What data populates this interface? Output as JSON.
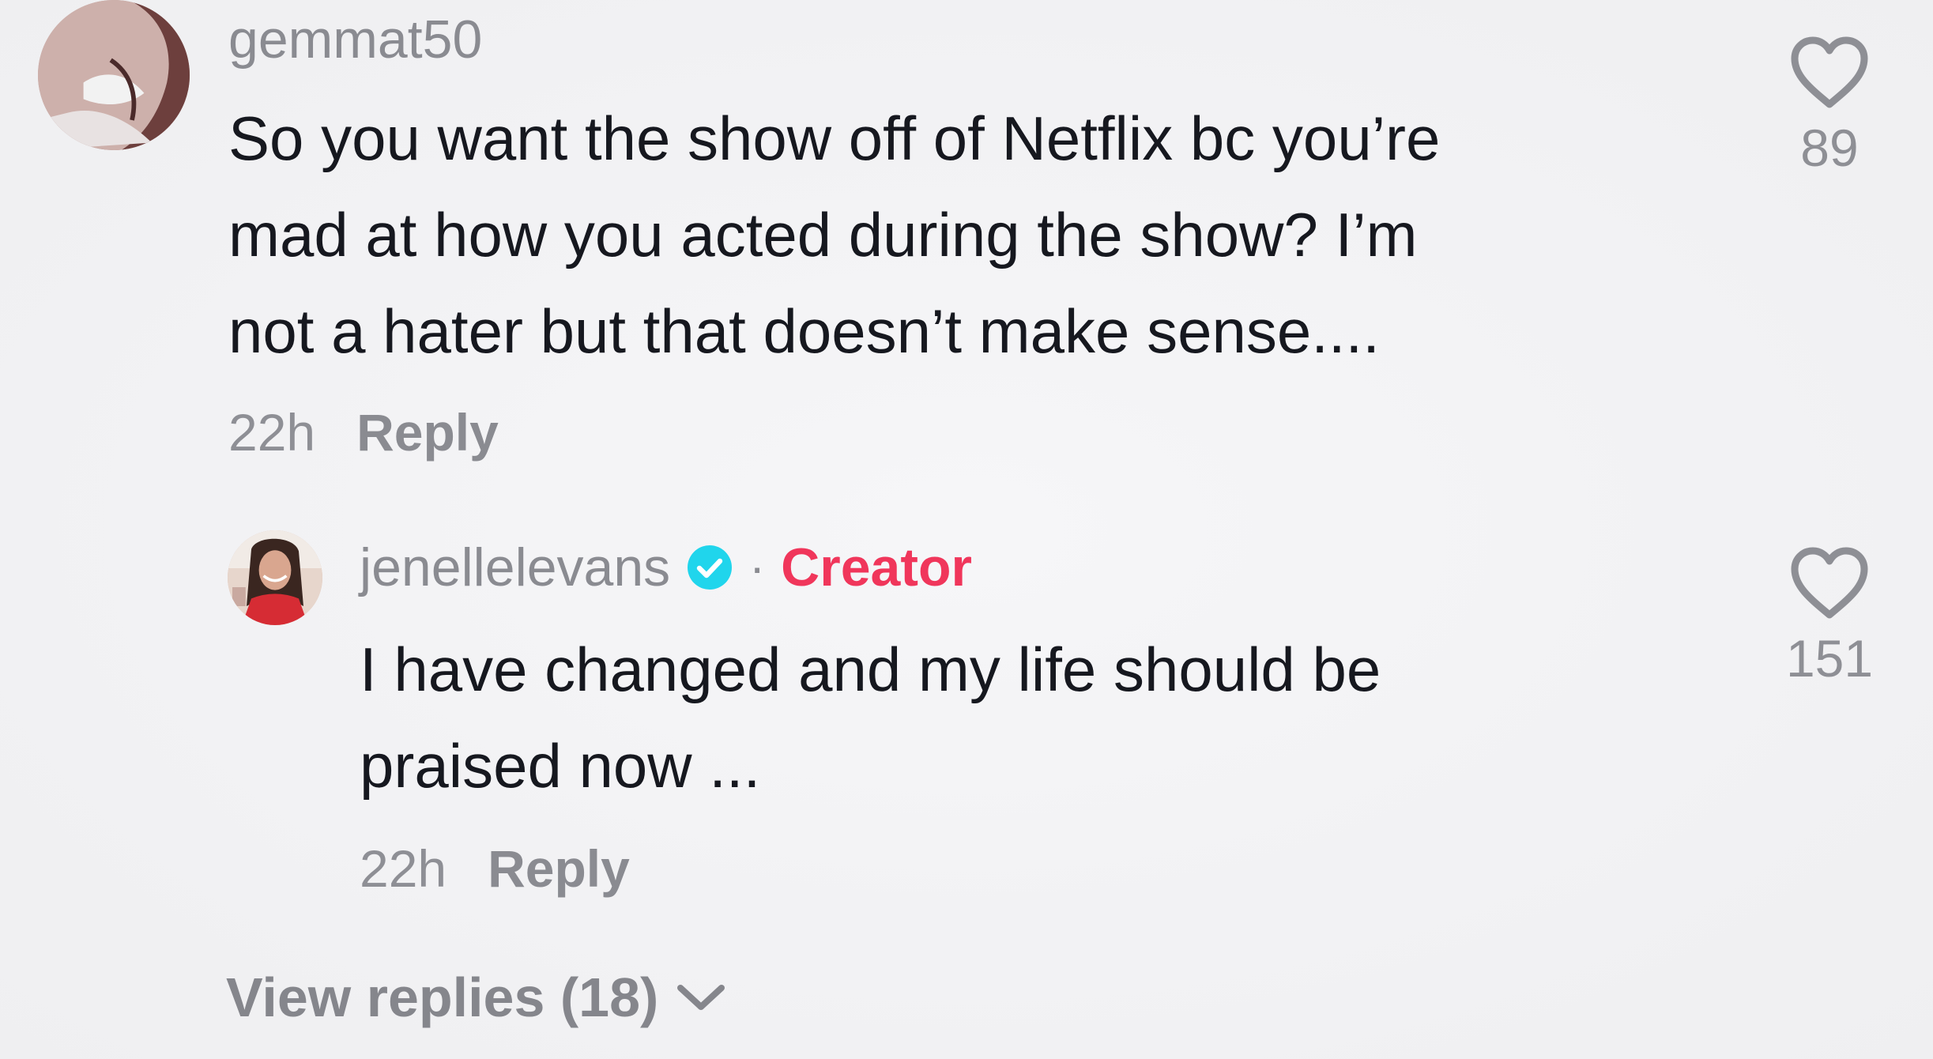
{
  "comment": {
    "username": "gemmat50",
    "text_lines": [
      "So you want the show off of Netflix bc you’re",
      "mad at how you acted during the show? I’m",
      "not a hater but that doesn’t make sense...."
    ],
    "timestamp": "22h",
    "reply_label": "Reply",
    "likes": "89",
    "like_icon": "heart-outline-icon"
  },
  "reply": {
    "username": "jenellelevans",
    "verified_icon": "verified-badge-icon",
    "separator": "·",
    "badge": "Creator",
    "text_lines": [
      "I have changed and my life should be",
      "praised now ..."
    ],
    "timestamp": "22h",
    "reply_label": "Reply",
    "likes": "151",
    "like_icon": "heart-outline-icon"
  },
  "view_replies": {
    "label": "View replies (18)",
    "icon": "chevron-down-icon"
  },
  "colors": {
    "background": "#f3f3f5",
    "text": "#16181f",
    "muted": "#8a8b91",
    "creator": "#f0365b",
    "verified": "#20d5ec"
  }
}
